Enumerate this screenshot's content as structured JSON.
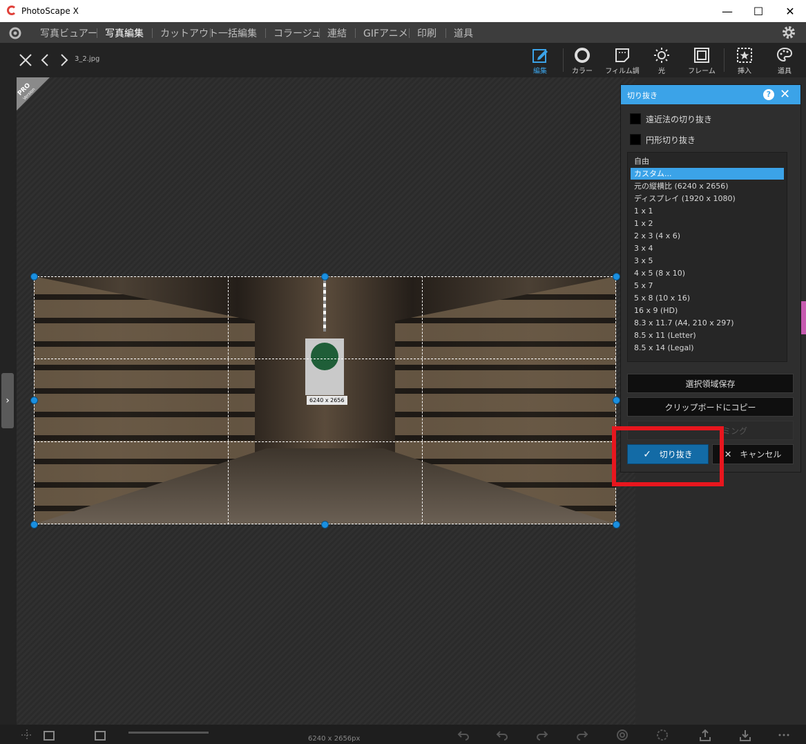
{
  "window": {
    "title": "PhotoScape X",
    "minimize": "—",
    "maximize": "☐",
    "close": "✕"
  },
  "menu": {
    "items": [
      "写真ビュアー",
      "写真編集",
      "カットアウト",
      "一括編集",
      "コラージュ",
      "連結",
      "GIFアニメ",
      "印刷",
      "道具"
    ],
    "active_index": 1
  },
  "topbar": {
    "filename": "3_2.jpg",
    "tools": [
      {
        "label": "編集",
        "icon": "edit-icon",
        "active": true
      },
      {
        "label": "カラー",
        "icon": "color-icon",
        "active": false
      },
      {
        "label": "フィルム調",
        "icon": "film-icon",
        "active": false
      },
      {
        "label": "光",
        "icon": "light-icon",
        "active": false
      },
      {
        "label": "フレーム",
        "icon": "frame-icon",
        "active": false
      },
      {
        "label": "挿入",
        "icon": "insert-icon",
        "active": false
      },
      {
        "label": "道具",
        "icon": "tools-icon",
        "active": false
      }
    ]
  },
  "badge": {
    "line1": "PRO",
    "line2": "Version"
  },
  "canvas": {
    "size_label": "6240 x 2656"
  },
  "panel": {
    "title": "切り抜き",
    "help": "?",
    "close": "✕",
    "checkboxes": [
      {
        "label": "遠近法の切り抜き",
        "checked": false
      },
      {
        "label": "円形切り抜き",
        "checked": false
      }
    ],
    "ratios": [
      "自由",
      "カスタム...",
      "元の縦横比 (6240 x 2656)",
      "ディスプレイ (1920 x 1080)",
      "1 x 1",
      "1 x 2",
      "2 x 3 (4 x 6)",
      "3 x 4",
      "3 x 5",
      "4 x 5 (8 x 10)",
      "5 x 7",
      "5 x 8 (10 x 16)",
      "16 x 9 (HD)",
      "8.3 x 11.7 (A4, 210 x 297)",
      "8.5 x 11 (Letter)",
      "8.5 x 14 (Legal)"
    ],
    "selected_ratio_index": 1,
    "save_selection": "選択領域保存",
    "copy_clipboard": "クリップボードにコピー",
    "auto_trim": "ミング",
    "crop": "切り抜き",
    "cancel": "キャンセル"
  },
  "statusbar": {
    "text": "6240 x 2656px"
  },
  "colors": {
    "accent": "#3ba3e8",
    "highlight": "#e8161e",
    "crop_button": "#136ba6"
  }
}
